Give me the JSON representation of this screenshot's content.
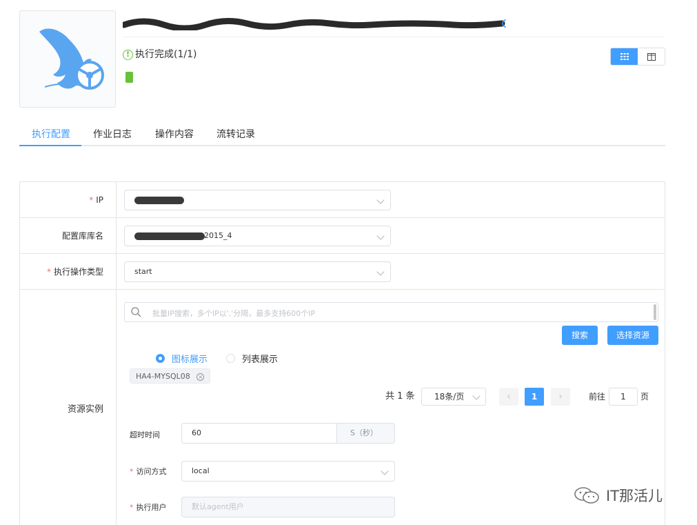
{
  "header": {
    "title": "",
    "status_text": "执行完成(1/1)",
    "status_icon": "info-icon"
  },
  "view_toggle": {
    "grid_icon": "grid-icon",
    "columns_icon": "columns-icon",
    "active": "grid"
  },
  "tabs": [
    {
      "label": "执行配置",
      "active": true
    },
    {
      "label": "作业日志",
      "active": false
    },
    {
      "label": "操作内容",
      "active": false
    },
    {
      "label": "流转记录",
      "active": false
    }
  ],
  "form": {
    "ip": {
      "label": "IP",
      "required": true,
      "value": ""
    },
    "config_db": {
      "label": "配置库库名",
      "required": false,
      "value_suffix": "2015_4"
    },
    "op_type": {
      "label": "执行操作类型",
      "required": true,
      "value": "start"
    },
    "resource": {
      "label": "资源实例",
      "search_placeholder": "批量IP搜索，多个IP以','分隔，最多支持600个IP",
      "search_button": "搜索",
      "select_button": "选择资源",
      "radio_icon": "图标展示",
      "radio_list": "列表展示",
      "selected_view": "icon",
      "tags": [
        "HA4-MYSQL08"
      ],
      "pager": {
        "total": "共 1 条",
        "page_size": "18条/页",
        "current_page": "1",
        "goto_prefix": "前往",
        "goto_value": "1",
        "goto_suffix": "页"
      }
    },
    "timeout": {
      "label": "超时时间",
      "value": "60",
      "unit": "S（秒）"
    },
    "access": {
      "label": "访问方式",
      "required": true,
      "value": "local"
    },
    "exec_user": {
      "label": "执行用户",
      "required": true,
      "placeholder": "默认agent用户"
    }
  },
  "watermark": {
    "text": "IT那活儿"
  },
  "colors": {
    "primary": "#409eff",
    "success": "#67c23a",
    "danger": "#f56c6c"
  }
}
